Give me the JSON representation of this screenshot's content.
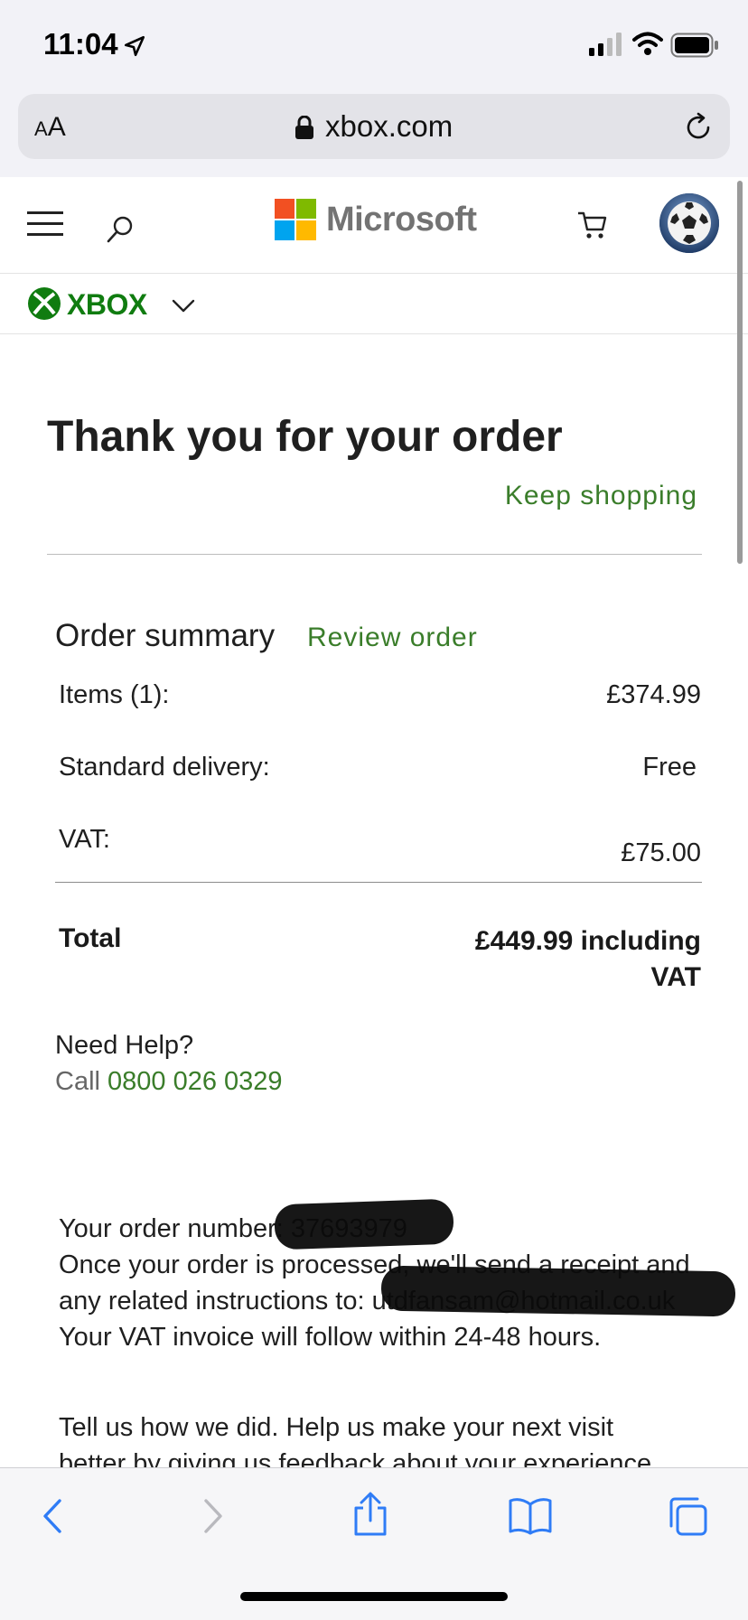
{
  "status_bar": {
    "time": "11:04"
  },
  "browser": {
    "text_size_label": "AA",
    "domain": "xbox.com"
  },
  "header": {
    "brand": "Microsoft",
    "sub_brand": "XBOX"
  },
  "page": {
    "title": "Thank you for your order",
    "keep_shopping": "Keep shopping",
    "order_summary": {
      "heading": "Order summary",
      "review_link": "Review order",
      "items_label": "Items (1):",
      "items_value": "£374.99",
      "delivery_label": "Standard delivery:",
      "delivery_value": "Free",
      "vat_label": "VAT:",
      "vat_value": "£75.00",
      "total_label": "Total",
      "total_value": "£449.99 including VAT"
    },
    "help": {
      "heading": "Need Help?",
      "call_prefix": "Call",
      "phone": "0800 026 0329"
    },
    "order_info": {
      "order_number_label": "Your order number: 37693979",
      "line2": "Once your order is processed, we'll send a receipt and",
      "line3": "any related instructions to: utdfansam@hotmail.co.uk",
      "line4": "Your VAT invoice will follow within 24-48 hours."
    },
    "feedback": {
      "line1": "Tell us how we did. Help us make your next visit",
      "line2": "better by giving us feedback about your experience"
    }
  },
  "colors": {
    "accent_green": "#3a7d2a",
    "xbox_green": "#107c10"
  }
}
